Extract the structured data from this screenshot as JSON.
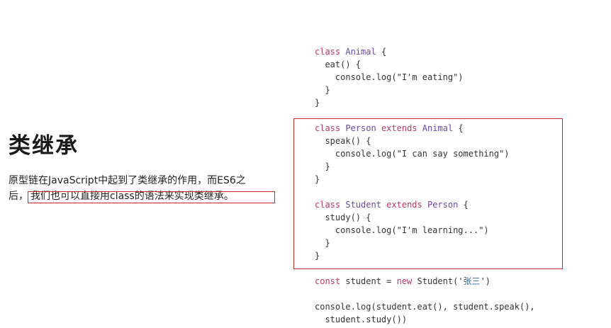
{
  "slide": {
    "title": "类继承",
    "desc_line1": "原型链在JavaScript中起到了类继承的作用，而ES6之",
    "desc_line2_prefix": "后，",
    "desc_line2_highlight": "我们也可以直接用class的语法来实现类继承。"
  },
  "code": {
    "animal": {
      "kw_class": "class",
      "name": "Animal",
      "open": " {",
      "method": "  eat() {",
      "log": "    console.log(\"I'm eating\")",
      "close_method": "  }",
      "close_class": "}"
    },
    "person": {
      "kw_class": "class",
      "name": "Person",
      "kw_extends": "extends",
      "parent": "Animal",
      "open": " {",
      "method": "  speak() {",
      "log": "    console.log(\"I can say something\")",
      "close_method": "  }",
      "close_class": "}"
    },
    "student": {
      "kw_class": "class",
      "name": "Student",
      "kw_extends": "extends",
      "parent": "Person",
      "open": " {",
      "method": "  study() {",
      "log": "    console.log(\"I'm learning...\")",
      "close_method": "  }",
      "close_class": "}"
    },
    "instance": {
      "kw_const": "const",
      "var_part": " student = ",
      "kw_new": "new",
      "call_part": " Student('",
      "arg": "张三",
      "call_end": "')"
    },
    "log_line1": "console.log(student.eat(), student.speak(),",
    "log_line2": "  student.study())"
  }
}
